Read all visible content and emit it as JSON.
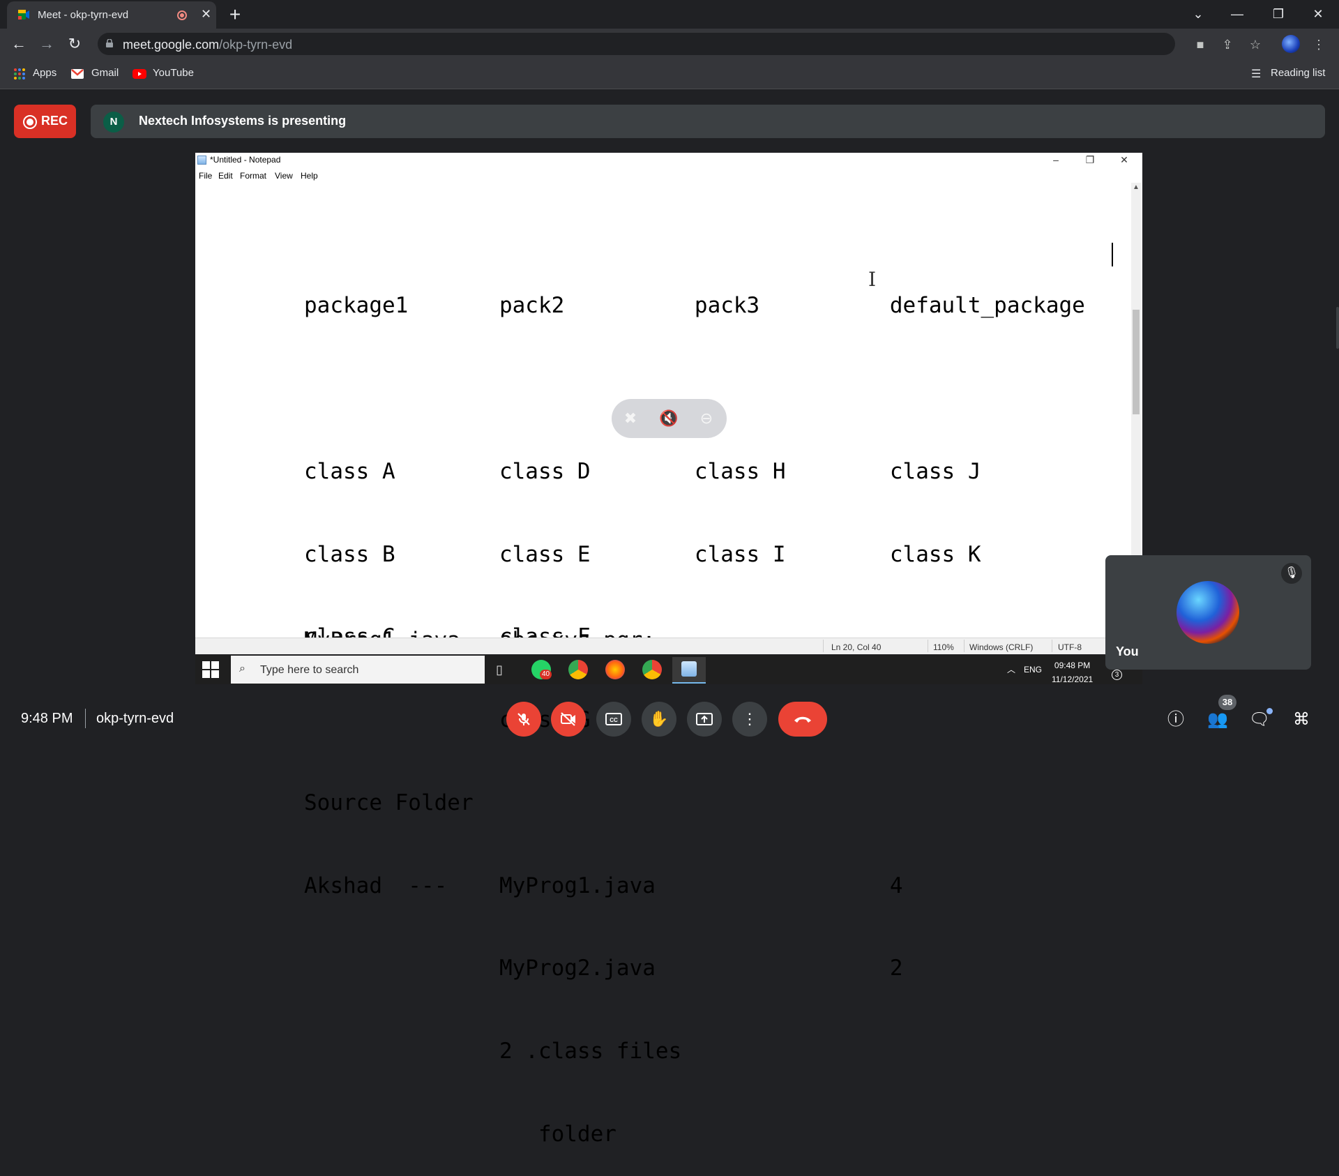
{
  "browser": {
    "tab_title": "Meet - okp-tyrn-evd",
    "tab_close": "✕",
    "new_tab": "+",
    "url_host": "meet.google.com",
    "url_path": "/okp-tyrn-evd",
    "window_controls": {
      "dropdown": "⌄",
      "minimize": "—",
      "restore": "❐",
      "close": "✕"
    },
    "bookmarks": [
      {
        "label": "Apps",
        "icon": "apps-grid-icon"
      },
      {
        "label": "Gmail",
        "icon": "gmail-icon"
      },
      {
        "label": "YouTube",
        "icon": "youtube-icon"
      }
    ],
    "reading_list": "Reading list"
  },
  "meet": {
    "rec_label": "REC",
    "presenter_initial": "N",
    "presenting_text": "Nextech Infosystems is presenting",
    "time": "9:48 PM",
    "meeting_code": "okp-tyrn-evd",
    "people_count": "38",
    "self_label": "You",
    "accent_red": "#ea4335"
  },
  "notepad": {
    "title": "*Untitled - Notepad",
    "menu": [
      "File",
      "Edit",
      "Format",
      "View",
      "Help"
    ],
    "lines": [
      "package1       pack2          pack3          default_package",
      "",
      "class A        class D        class H        class J",
      "class B        class E        class I        class K",
      "class C        class F",
      "               class G",
      "Source Folder",
      "Akshad  ---    MyProg1.java                  4",
      "               MyProg2.java                  2",
      "               2 .class files",
      "                  folder"
    ],
    "cut_line": "MyProg1.java   abc.xyz.pqr;",
    "status": {
      "position": "Ln 20, Col 40",
      "zoom": "110%",
      "line_endings": "Windows (CRLF)",
      "encoding": "UTF-8"
    }
  },
  "taskbar": {
    "search_placeholder": "Type here to search",
    "whatsapp_badge": "40",
    "ime": "ENG",
    "time": "09:48 PM",
    "date": "11/12/2021",
    "notifications": "3"
  }
}
